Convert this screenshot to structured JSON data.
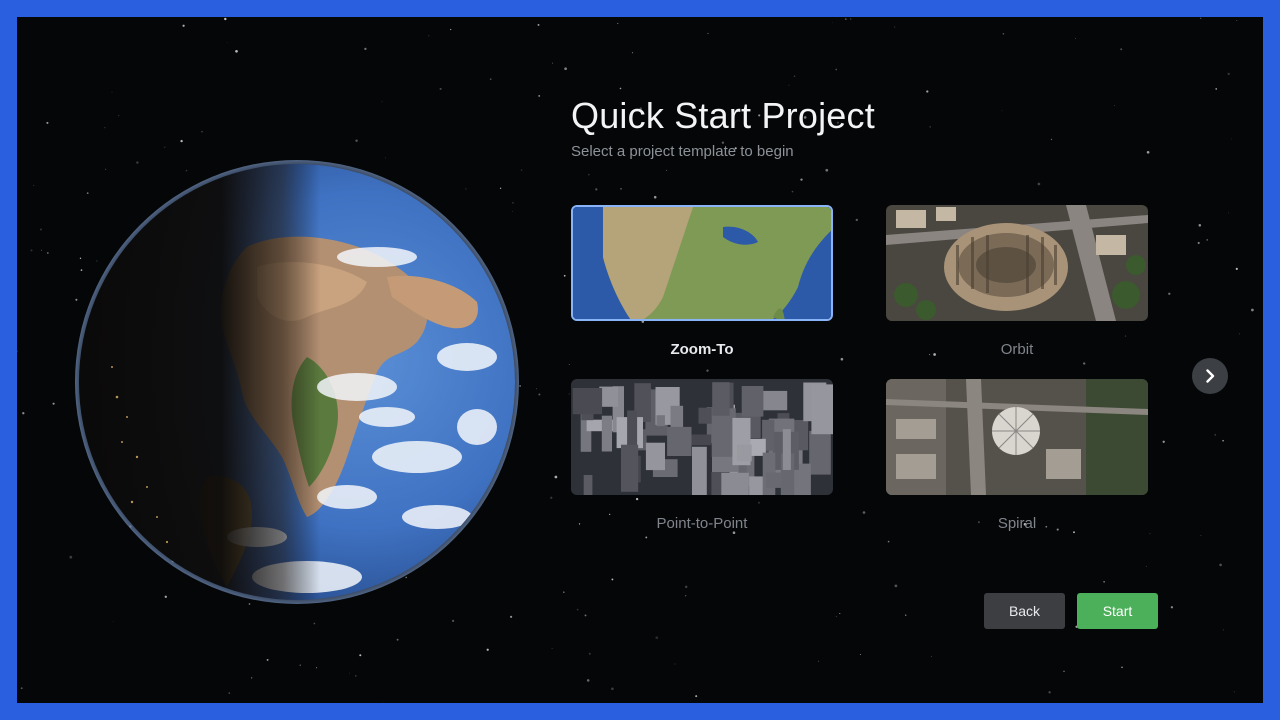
{
  "header": {
    "title": "Quick Start Project",
    "subtitle": "Select a project template to begin"
  },
  "templates": [
    {
      "label": "Zoom-To",
      "selected": true
    },
    {
      "label": "Orbit",
      "selected": false
    },
    {
      "label": "Point-to-Point",
      "selected": false
    },
    {
      "label": "Spiral",
      "selected": false
    }
  ],
  "buttons": {
    "back_label": "Back",
    "start_label": "Start"
  },
  "icons": {
    "next": "chevron-right-icon"
  },
  "colors": {
    "frame_border": "#2a5fe0",
    "selected_outline": "#8ab4f8",
    "start_button": "#4caf5a",
    "back_button": "#3c3e42"
  }
}
